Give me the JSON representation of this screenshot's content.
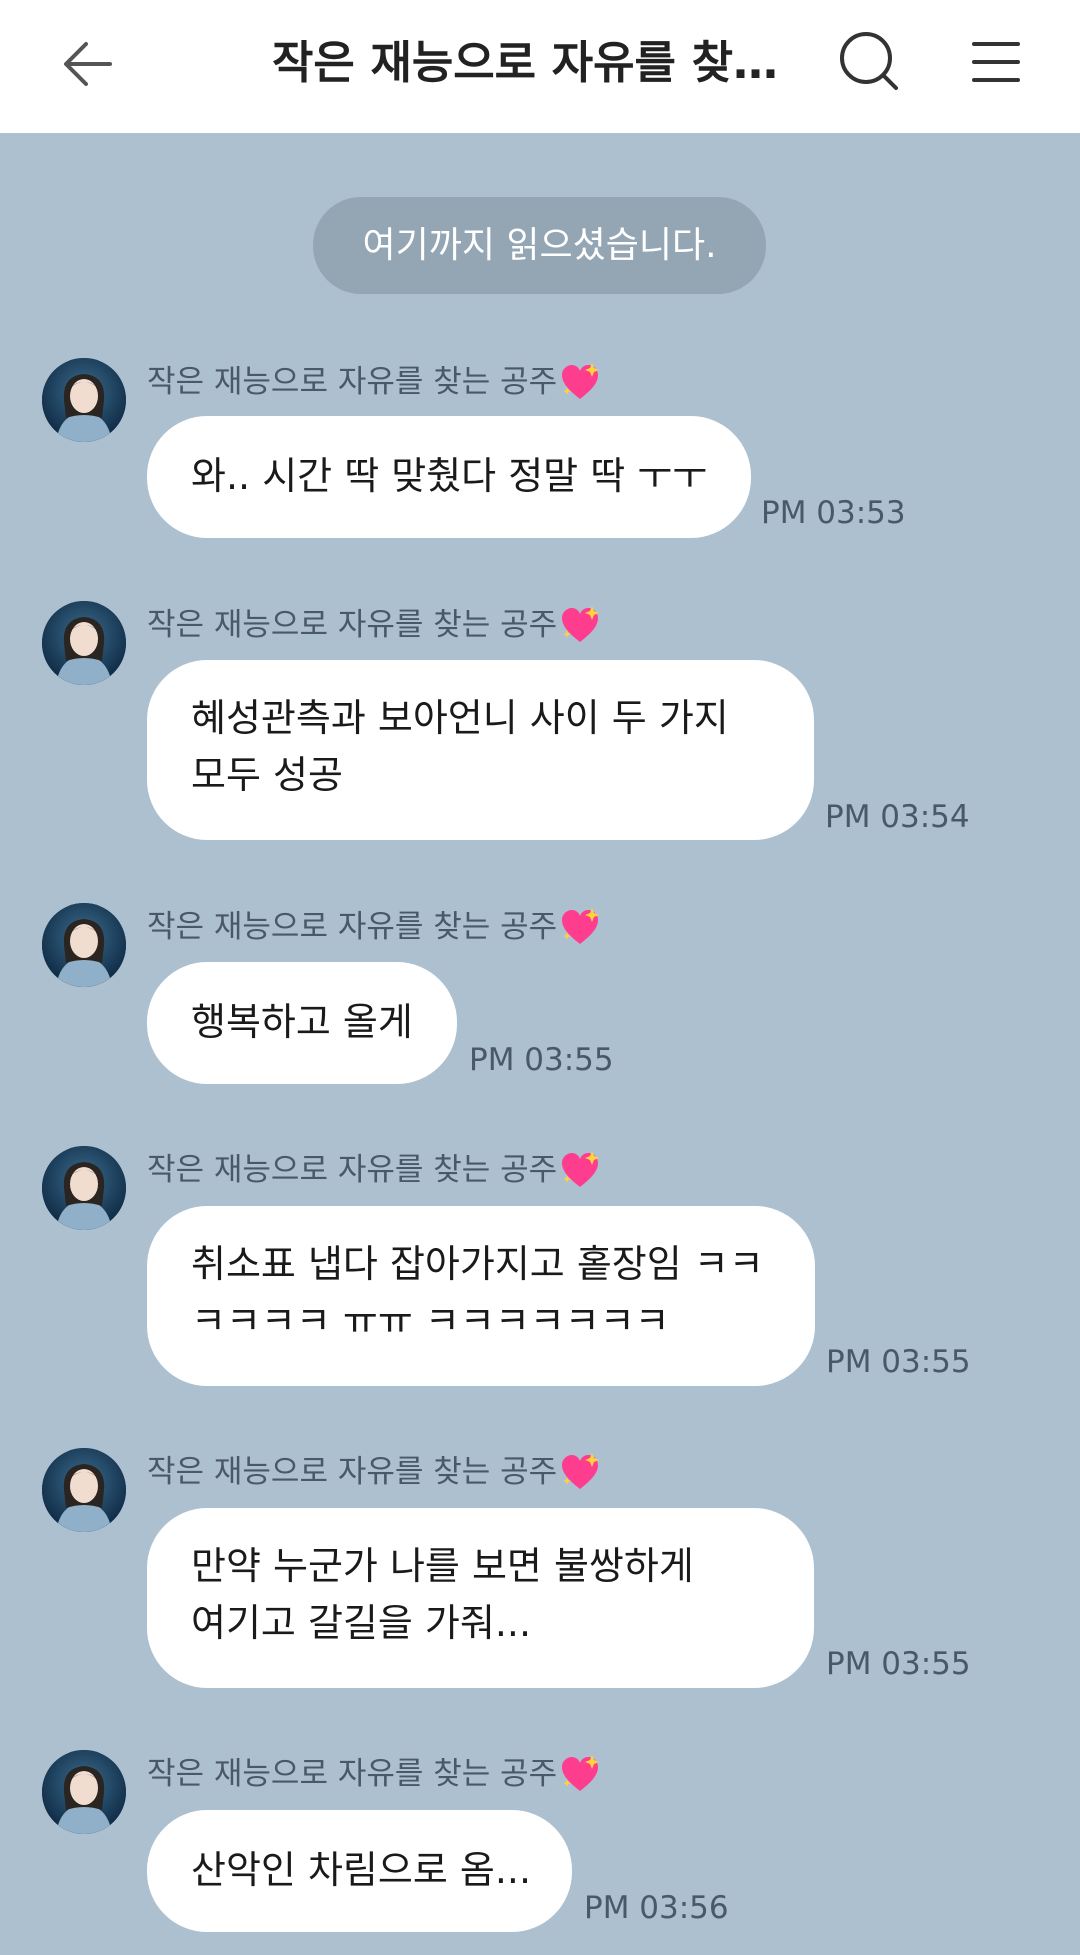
{
  "header": {
    "title": "작은 재능으로 자유를 찾는 ..."
  },
  "divider": {
    "text": "여기까지 읽으셨습니다."
  },
  "messages": [
    {
      "sender": "작은 재능으로 자유를 찾는 공주",
      "text": "와.. 시간 딱 맞췄다 정말 딱 ㅜㅜ",
      "time": "PM 03:53"
    },
    {
      "sender": "작은 재능으로 자유를 찾는 공주",
      "text": "혜성관측과 보아언니 사이 두 가지\n모두 성공",
      "time": "PM 03:54"
    },
    {
      "sender": "작은 재능으로 자유를 찾는 공주",
      "text": "행복하고 올게",
      "time": "PM 03:55"
    },
    {
      "sender": "작은 재능으로 자유를 찾는 공주",
      "text": "취소표 냅다 잡아가지고 홑장임 ㅋㅋ\nㅋㅋㅋㅋ ㅠㅠ ㅋㅋㅋㅋㅋㅋㅋ",
      "time": "PM 03:55"
    },
    {
      "sender": "작은 재능으로 자유를 찾는 공주",
      "text": "만약 누군가 나를 보면 불쌍하게\n여기고 갈길을 가줘...",
      "time": "PM 03:55"
    },
    {
      "sender": "작은 재능으로 자유를 찾는 공주",
      "text": "산악인 차림으로 옴...",
      "time": "PM 03:56"
    }
  ],
  "icons": {
    "back": "back-arrow-icon",
    "search": "search-icon",
    "menu": "menu-icon",
    "sender_emoji": "sparkling-heart-emoji"
  },
  "colors": {
    "background": "#adc0d0",
    "bubble": "#ffffff",
    "divider": "#94a5b4",
    "header": "#ffffff",
    "heart": "#ff3d8e"
  }
}
